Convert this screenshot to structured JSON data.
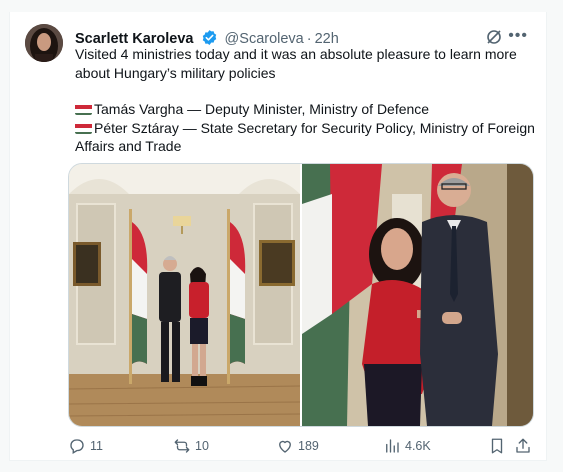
{
  "tweet": {
    "author_name": "Scarlett Karoleva",
    "handle": "@Scaroleva",
    "separator": "·",
    "time": "22h",
    "text_line1": "Visited 4 ministries today and it was an absolute pleasure to learn more about Hungary’s military policies",
    "text_line2": "Tamás Vargha — Deputy Minister, Ministry of Defence",
    "text_line3": "Péter Sztáray — State Secretary for Security Policy, Ministry of Foreign Affairs and Trade",
    "more_label": "•••"
  },
  "actions": {
    "replies": "11",
    "reposts": "10",
    "likes": "189",
    "views": "4.6K"
  },
  "icons": {
    "verified": "verified-badge-icon",
    "grok": "grok-icon",
    "more": "more-icon",
    "reply": "reply-icon",
    "repost": "repost-icon",
    "like": "like-icon",
    "views": "views-icon",
    "bookmark": "bookmark-icon",
    "share": "share-icon"
  },
  "colors": {
    "accent": "#1d9bf0",
    "text": "#0f1419",
    "secondary": "#536471",
    "flag_red": "#ce2939",
    "flag_white": "#ffffff",
    "flag_green": "#477050"
  }
}
